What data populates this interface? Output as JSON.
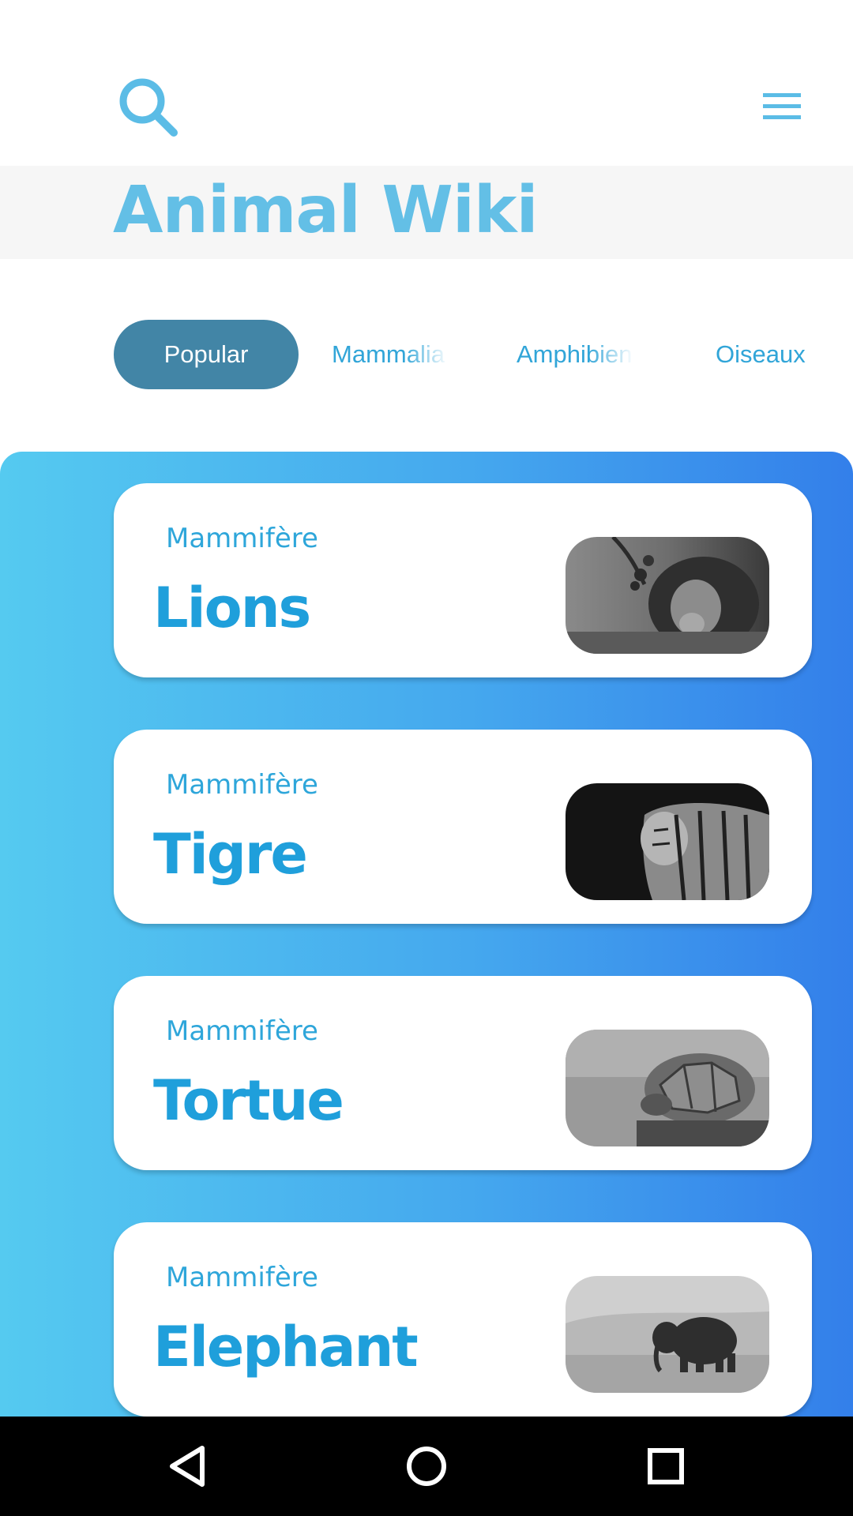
{
  "app": {
    "title": "Animal Wiki"
  },
  "header": {
    "search_icon": "search-icon",
    "menu_icon": "hamburger-menu-icon"
  },
  "tabs": [
    {
      "label": "Popular",
      "active": true
    },
    {
      "label": "Mammalia",
      "active": false
    },
    {
      "label": "Amphibien",
      "active": false
    },
    {
      "label": "Oiseaux",
      "active": false
    }
  ],
  "animals": [
    {
      "category": "Mammifère",
      "name": "Lions",
      "image": "lion-photo"
    },
    {
      "category": "Mammifère",
      "name": "Tigre",
      "image": "tiger-photo"
    },
    {
      "category": "Mammifère",
      "name": "Tortue",
      "image": "tortoise-photo"
    },
    {
      "category": "Mammifère",
      "name": "Elephant",
      "image": "elephant-photo"
    }
  ],
  "navbar": {
    "back_icon": "back-triangle-icon",
    "home_icon": "home-circle-icon",
    "recents_icon": "recents-square-icon"
  },
  "colors": {
    "accent": "#63bfe6",
    "tab_active_bg": "#4285a6",
    "gradient_start": "#55caf0",
    "gradient_end": "#337fea",
    "card_text": "#1f9fdb"
  }
}
